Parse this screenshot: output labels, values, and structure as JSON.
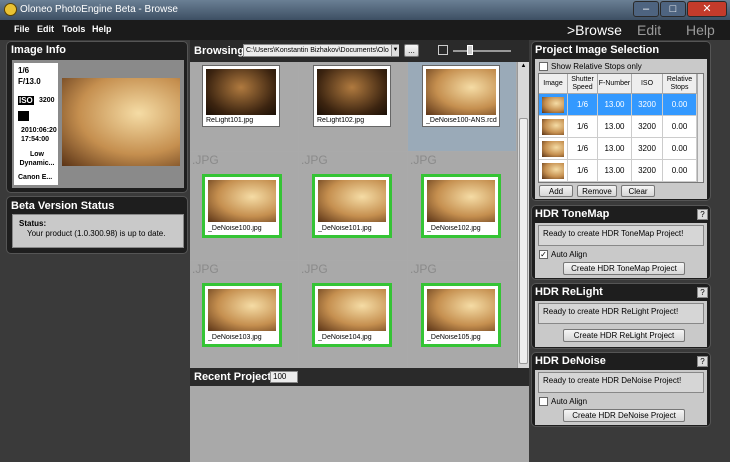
{
  "window": {
    "title": "Oloneo PhotoEngine Beta - Browse"
  },
  "menu": {
    "file": "File",
    "edit": "Edit",
    "tools": "Tools",
    "help": "Help"
  },
  "modes": {
    "browse": ">Browse",
    "edit": "Edit",
    "help": "Help"
  },
  "image_info": {
    "title": "Image Info",
    "shutter": "1/6",
    "aperture": "F/13.0",
    "iso_label": "ISO",
    "iso": "3200",
    "date": "2010:06:20",
    "time": "17:54:00",
    "dynamic": "Low Dynamic...",
    "camera": "Canon E..."
  },
  "beta_status": {
    "title": "Beta Version Status",
    "label": "Status:",
    "text": "Your product (1.0.300.98) is up to date."
  },
  "browse": {
    "label": "Browsing:",
    "path": "C:\\Users\\Konstantin Bizhakov\\Documents\\Olo",
    "browse_btn": "...",
    "top_thumbs": [
      "ReLight101.jpg",
      "ReLight102.jpg",
      "_DeNoise100-ANS.rcd"
    ],
    "row2": {
      "ext": [
        ".JPG",
        ".JPG",
        ".JPG"
      ],
      "names": [
        "_DeNoise100.jpg",
        "_DeNoise101.jpg",
        "_DeNoise102.jpg"
      ]
    },
    "row3": {
      "ext": [
        ".JPG",
        ".JPG",
        ".JPG"
      ],
      "names": [
        "_DeNoise103.jpg",
        "_DeNoise104.jpg",
        "_DeNoise105.jpg"
      ]
    }
  },
  "recent": {
    "label": "Recent Projects:",
    "count": "100"
  },
  "selection": {
    "title": "Project Image Selection",
    "show_rel": "Show Relative Stops only",
    "headers": [
      "Image",
      "Shutter Speed",
      "F-Number",
      "ISO",
      "Relative Stops"
    ],
    "rows": [
      {
        "shutter": "1/6",
        "fnum": "13.00",
        "iso": "3200",
        "rel": "0.00"
      },
      {
        "shutter": "1/6",
        "fnum": "13.00",
        "iso": "3200",
        "rel": "0.00"
      },
      {
        "shutter": "1/6",
        "fnum": "13.00",
        "iso": "3200",
        "rel": "0.00"
      },
      {
        "shutter": "1/6",
        "fnum": "13.00",
        "iso": "3200",
        "rel": "0.00"
      }
    ],
    "add": "Add",
    "remove": "Remove",
    "clear": "Clear"
  },
  "tonemap": {
    "title": "HDR ToneMap",
    "help": "?",
    "status": "Ready to create HDR ToneMap Project!",
    "auto_align": "Auto Align",
    "create": "Create HDR ToneMap Project"
  },
  "relight": {
    "title": "HDR ReLight",
    "help": "?",
    "status": "Ready to create HDR ReLight Project!",
    "create": "Create HDR ReLight Project"
  },
  "denoise": {
    "title": "HDR DeNoise",
    "help": "?",
    "status": "Ready to create HDR DeNoise Project!",
    "auto_align": "Auto Align",
    "create": "Create HDR DeNoise Project"
  },
  "colors": {
    "accent": "#35c435",
    "selection": "#3399ff"
  }
}
